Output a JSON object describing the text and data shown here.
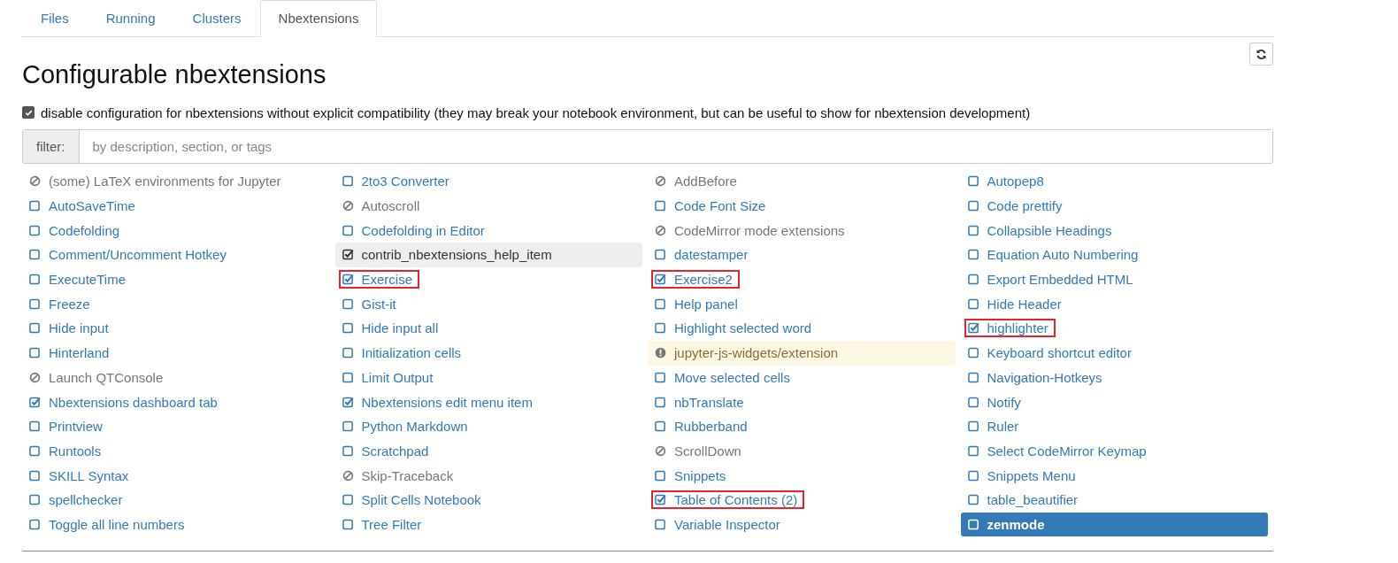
{
  "tabs": [
    {
      "label": "Files",
      "selected": false
    },
    {
      "label": "Running",
      "selected": false
    },
    {
      "label": "Clusters",
      "selected": false
    },
    {
      "label": "Nbextensions",
      "selected": true
    }
  ],
  "title": "Configurable nbextensions",
  "compat_option": {
    "label": "disable configuration for nbextensions without explicit compatibility (they may break your notebook environment, but can be useful to show for nbextension development)",
    "checked": true
  },
  "filter": {
    "label": "filter:",
    "placeholder": "by description, section, or tags"
  },
  "columns": [
    [
      {
        "label": "(some) LaTeX environments for Jupyter",
        "kind": "unconfigurable",
        "selected": false,
        "hovered": false,
        "marked": false
      },
      {
        "label": "AutoSaveTime",
        "kind": "checkbox",
        "checked": false,
        "selected": false,
        "hovered": false,
        "marked": false
      },
      {
        "label": "Codefolding",
        "kind": "checkbox",
        "checked": false,
        "selected": false,
        "hovered": false,
        "marked": false
      },
      {
        "label": "Comment/Uncomment Hotkey",
        "kind": "checkbox",
        "checked": false,
        "selected": false,
        "hovered": false,
        "marked": false
      },
      {
        "label": "ExecuteTime",
        "kind": "checkbox",
        "checked": false,
        "selected": false,
        "hovered": false,
        "marked": false
      },
      {
        "label": "Freeze",
        "kind": "checkbox",
        "checked": false,
        "selected": false,
        "hovered": false,
        "marked": false
      },
      {
        "label": "Hide input",
        "kind": "checkbox",
        "checked": false,
        "selected": false,
        "hovered": false,
        "marked": false
      },
      {
        "label": "Hinterland",
        "kind": "checkbox",
        "checked": false,
        "selected": false,
        "hovered": false,
        "marked": false
      },
      {
        "label": "Launch QTConsole",
        "kind": "unconfigurable",
        "selected": false,
        "hovered": false,
        "marked": false
      },
      {
        "label": "Nbextensions dashboard tab",
        "kind": "checkbox",
        "checked": true,
        "selected": false,
        "hovered": false,
        "marked": false
      },
      {
        "label": "Printview",
        "kind": "checkbox",
        "checked": false,
        "selected": false,
        "hovered": false,
        "marked": false
      },
      {
        "label": "Runtools",
        "kind": "checkbox",
        "checked": false,
        "selected": false,
        "hovered": false,
        "marked": false
      },
      {
        "label": "SKILL Syntax",
        "kind": "checkbox",
        "checked": false,
        "selected": false,
        "hovered": false,
        "marked": false
      },
      {
        "label": "spellchecker",
        "kind": "checkbox",
        "checked": false,
        "selected": false,
        "hovered": false,
        "marked": false
      },
      {
        "label": "Toggle all line numbers",
        "kind": "checkbox",
        "checked": false,
        "selected": false,
        "hovered": false,
        "marked": false
      }
    ],
    [
      {
        "label": "2to3 Converter",
        "kind": "checkbox",
        "checked": false,
        "selected": false,
        "hovered": false,
        "marked": false
      },
      {
        "label": "Autoscroll",
        "kind": "unconfigurable",
        "selected": false,
        "hovered": false,
        "marked": false
      },
      {
        "label": "Codefolding in Editor",
        "kind": "checkbox",
        "checked": false,
        "selected": false,
        "hovered": false,
        "marked": false
      },
      {
        "label": "contrib_nbextensions_help_item",
        "kind": "checkbox",
        "checked": true,
        "selected": false,
        "hovered": true,
        "marked": false
      },
      {
        "label": "Exercise",
        "kind": "checkbox",
        "checked": true,
        "selected": false,
        "hovered": false,
        "marked": true
      },
      {
        "label": "Gist-it",
        "kind": "checkbox",
        "checked": false,
        "selected": false,
        "hovered": false,
        "marked": false
      },
      {
        "label": "Hide input all",
        "kind": "checkbox",
        "checked": false,
        "selected": false,
        "hovered": false,
        "marked": false
      },
      {
        "label": "Initialization cells",
        "kind": "checkbox",
        "checked": false,
        "selected": false,
        "hovered": false,
        "marked": false
      },
      {
        "label": "Limit Output",
        "kind": "checkbox",
        "checked": false,
        "selected": false,
        "hovered": false,
        "marked": false
      },
      {
        "label": "Nbextensions edit menu item",
        "kind": "checkbox",
        "checked": true,
        "selected": false,
        "hovered": false,
        "marked": false
      },
      {
        "label": "Python Markdown",
        "kind": "checkbox",
        "checked": false,
        "selected": false,
        "hovered": false,
        "marked": false
      },
      {
        "label": "Scratchpad",
        "kind": "checkbox",
        "checked": false,
        "selected": false,
        "hovered": false,
        "marked": false
      },
      {
        "label": "Skip-Traceback",
        "kind": "unconfigurable",
        "selected": false,
        "hovered": false,
        "marked": false
      },
      {
        "label": "Split Cells Notebook",
        "kind": "checkbox",
        "checked": false,
        "selected": false,
        "hovered": false,
        "marked": false
      },
      {
        "label": "Tree Filter",
        "kind": "checkbox",
        "checked": false,
        "selected": false,
        "hovered": false,
        "marked": false
      }
    ],
    [
      {
        "label": "AddBefore",
        "kind": "unconfigurable",
        "selected": false,
        "hovered": false,
        "marked": false
      },
      {
        "label": "Code Font Size",
        "kind": "checkbox",
        "checked": false,
        "selected": false,
        "hovered": false,
        "marked": false
      },
      {
        "label": "CodeMirror mode extensions",
        "kind": "unconfigurable",
        "selected": false,
        "hovered": false,
        "marked": false
      },
      {
        "label": "datestamper",
        "kind": "checkbox",
        "checked": false,
        "selected": false,
        "hovered": false,
        "marked": false
      },
      {
        "label": "Exercise2",
        "kind": "checkbox",
        "checked": true,
        "selected": false,
        "hovered": false,
        "marked": true
      },
      {
        "label": "Help panel",
        "kind": "checkbox",
        "checked": false,
        "selected": false,
        "hovered": false,
        "marked": false
      },
      {
        "label": "Highlight selected word",
        "kind": "checkbox",
        "checked": false,
        "selected": false,
        "hovered": false,
        "marked": false
      },
      {
        "label": "jupyter-js-widgets/extension",
        "kind": "warning",
        "selected": false,
        "hovered": false,
        "marked": false
      },
      {
        "label": "Move selected cells",
        "kind": "checkbox",
        "checked": false,
        "selected": false,
        "hovered": false,
        "marked": false
      },
      {
        "label": "nbTranslate",
        "kind": "checkbox",
        "checked": false,
        "selected": false,
        "hovered": false,
        "marked": false
      },
      {
        "label": "Rubberband",
        "kind": "checkbox",
        "checked": false,
        "selected": false,
        "hovered": false,
        "marked": false
      },
      {
        "label": "ScrollDown",
        "kind": "unconfigurable",
        "selected": false,
        "hovered": false,
        "marked": false
      },
      {
        "label": "Snippets",
        "kind": "checkbox",
        "checked": false,
        "selected": false,
        "hovered": false,
        "marked": false
      },
      {
        "label": "Table of Contents (2)",
        "kind": "checkbox",
        "checked": true,
        "selected": false,
        "hovered": false,
        "marked": true
      },
      {
        "label": "Variable Inspector",
        "kind": "checkbox",
        "checked": false,
        "selected": false,
        "hovered": false,
        "marked": false
      }
    ],
    [
      {
        "label": "Autopep8",
        "kind": "checkbox",
        "checked": false,
        "selected": false,
        "hovered": false,
        "marked": false
      },
      {
        "label": "Code prettify",
        "kind": "checkbox",
        "checked": false,
        "selected": false,
        "hovered": false,
        "marked": false
      },
      {
        "label": "Collapsible Headings",
        "kind": "checkbox",
        "checked": false,
        "selected": false,
        "hovered": false,
        "marked": false
      },
      {
        "label": "Equation Auto Numbering",
        "kind": "checkbox",
        "checked": false,
        "selected": false,
        "hovered": false,
        "marked": false
      },
      {
        "label": "Export Embedded HTML",
        "kind": "checkbox",
        "checked": false,
        "selected": false,
        "hovered": false,
        "marked": false
      },
      {
        "label": "Hide Header",
        "kind": "checkbox",
        "checked": false,
        "selected": false,
        "hovered": false,
        "marked": false
      },
      {
        "label": "highlighter",
        "kind": "checkbox",
        "checked": true,
        "selected": false,
        "hovered": false,
        "marked": true
      },
      {
        "label": "Keyboard shortcut editor",
        "kind": "checkbox",
        "checked": false,
        "selected": false,
        "hovered": false,
        "marked": false
      },
      {
        "label": "Navigation-Hotkeys",
        "kind": "checkbox",
        "checked": false,
        "selected": false,
        "hovered": false,
        "marked": false
      },
      {
        "label": "Notify",
        "kind": "checkbox",
        "checked": false,
        "selected": false,
        "hovered": false,
        "marked": false
      },
      {
        "label": "Ruler",
        "kind": "checkbox",
        "checked": false,
        "selected": false,
        "hovered": false,
        "marked": false
      },
      {
        "label": "Select CodeMirror Keymap",
        "kind": "checkbox",
        "checked": false,
        "selected": false,
        "hovered": false,
        "marked": false
      },
      {
        "label": "Snippets Menu",
        "kind": "checkbox",
        "checked": false,
        "selected": false,
        "hovered": false,
        "marked": false
      },
      {
        "label": "table_beautifier",
        "kind": "checkbox",
        "checked": false,
        "selected": false,
        "hovered": false,
        "marked": false
      },
      {
        "label": "zenmode",
        "kind": "checkbox",
        "checked": false,
        "selected": true,
        "hovered": false,
        "marked": false
      }
    ]
  ]
}
